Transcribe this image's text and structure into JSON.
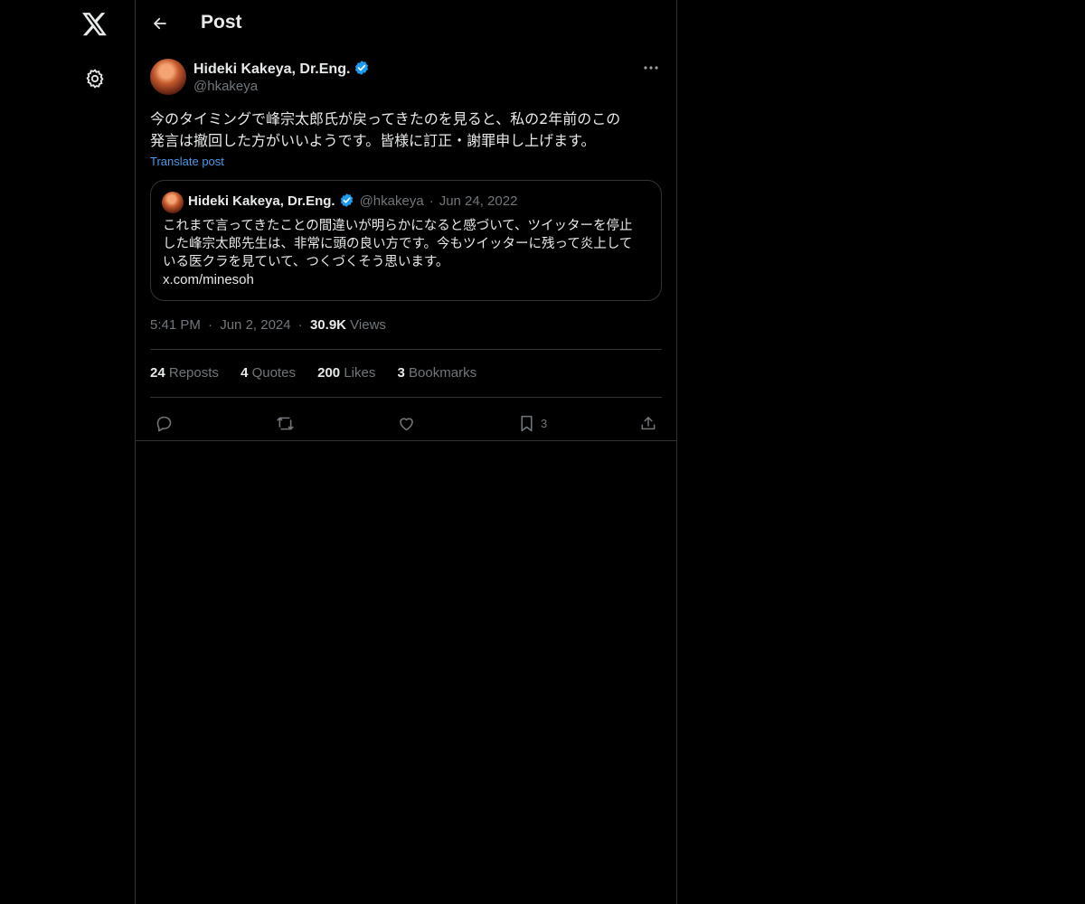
{
  "header": {
    "title": "Post"
  },
  "post": {
    "author_name": "Hideki Kakeya, Dr.Eng.",
    "author_handle": "@hkakeya",
    "text_line1": "今のタイミングで峰宗太郎氏が戻ってきたのを見ると、私の2年前のこの",
    "text_line2": "発言は撤回した方がいいようです。皆様に訂正・謝罪申し上げます。",
    "translate_label": "Translate post",
    "time": "5:41 PM",
    "date": "Jun 2, 2024",
    "views_count": "30.9K",
    "views_label": "Views",
    "separator": "·"
  },
  "quote": {
    "author_name": "Hideki Kakeya, Dr.Eng.",
    "author_handle": "@hkakeya",
    "separator": "·",
    "date": "Jun 24, 2022",
    "text_line1": "これまで言ってきたことの間違いが明らかになると感づいて、ツイッターを停止",
    "text_line2": "した峰宗太郎先生は、非常に頭の良い方です。今もツイッターに残って炎上して",
    "text_line3": "いる医クラを見ていて、つくづくそう思います。",
    "link": "x.com/minesoh"
  },
  "stats": {
    "reposts_count": "24",
    "reposts_label": "Reposts",
    "quotes_count": "4",
    "quotes_label": "Quotes",
    "likes_count": "200",
    "likes_label": "Likes",
    "bookmarks_count": "3",
    "bookmarks_label": "Bookmarks"
  },
  "actions": {
    "bookmark_count": "3"
  },
  "icons": {
    "logo": "x-logo-icon",
    "settings": "gear-icon",
    "back": "arrow-left-icon",
    "more": "more-horizontal-icon",
    "verified": "verified-badge-icon",
    "reply": "reply-icon",
    "repost": "repost-icon",
    "like": "heart-icon",
    "bookmark": "bookmark-icon",
    "share": "share-icon"
  },
  "colors": {
    "background": "#000000",
    "text": "#e7e9ea",
    "muted": "#71767b",
    "accent": "#1d9bf0",
    "border": "#2f3336"
  }
}
